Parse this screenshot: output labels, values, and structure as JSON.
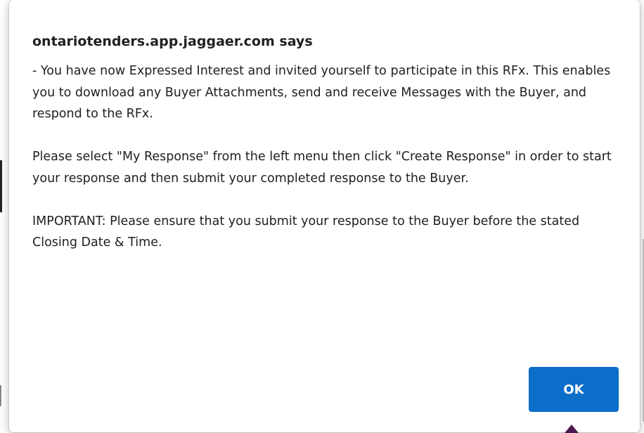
{
  "dialog": {
    "title": "ontariotenders.app.jaggaer.com says",
    "paragraphs": [
      "- You have now Expressed Interest and invited yourself to participate in this RFx. This enables you to download any Buyer Attachments, send and receive Messages with the Buyer, and respond to the RFx.",
      "Please select \"My Response\" from the left menu then click \"Create Response\" in order to start your response and then submit your completed response to the Buyer.",
      "IMPORTANT: Please ensure that you submit your response to the Buyer before the stated Closing Date & Time."
    ],
    "ok_label": "OK",
    "ok_color": "#0b6fc9"
  }
}
